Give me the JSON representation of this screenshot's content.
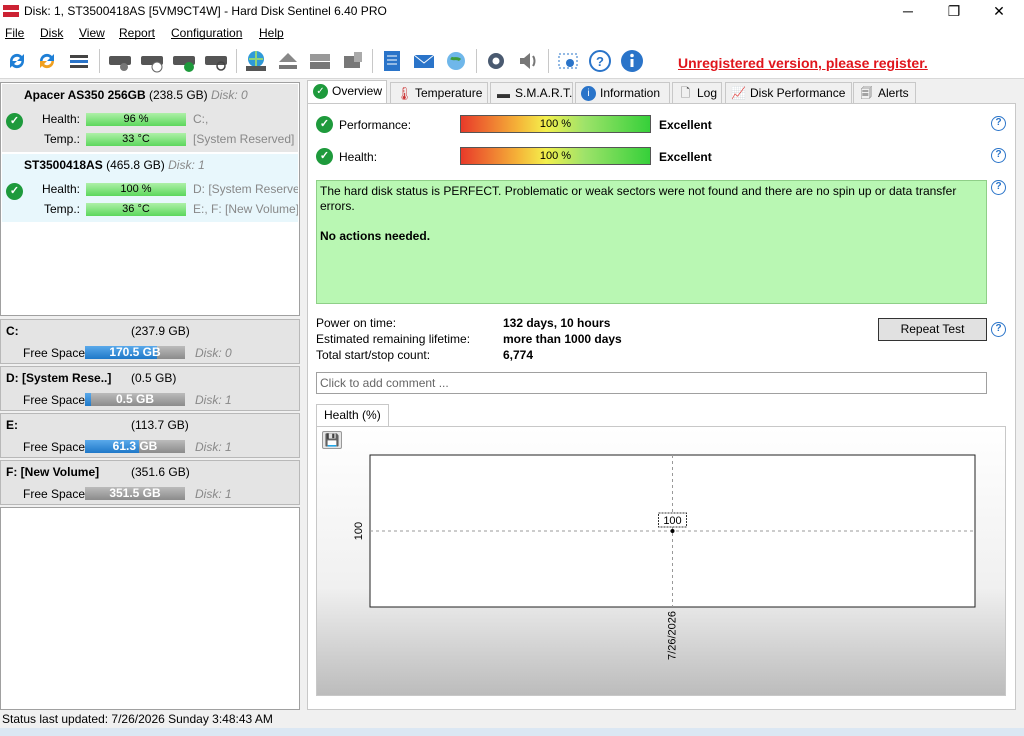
{
  "window": {
    "title": "Disk: 1, ST3500418AS [5VM9CT4W]  -  Hard Disk Sentinel 6.40 PRO",
    "minimize": "─",
    "maximize": "❐",
    "close": "✕"
  },
  "menu": [
    "File",
    "Disk",
    "View",
    "Report",
    "Configuration",
    "Help"
  ],
  "toolbar": {
    "unregistered": "Unregistered version, please register."
  },
  "disks": [
    {
      "name": "Apacer AS350 256GB",
      "size": "(238.5 GB)",
      "index": "Disk: 0",
      "health_label": "Health:",
      "health": "96 %",
      "temp_label": "Temp.:",
      "temp": "33 °C",
      "vol_line1": "C:,",
      "vol_line2": "[System Reserved]"
    },
    {
      "name": "ST3500418AS",
      "size": "(465.8 GB)",
      "index": "Disk: 1",
      "health_label": "Health:",
      "health": "100 %",
      "temp_label": "Temp.:",
      "temp": "36 °C",
      "vol_line1": "D: [System Reserved]",
      "vol_line2": "E:, F: [New Volume]"
    }
  ],
  "volumes": [
    {
      "name": "C:",
      "size": "(237.9 GB)",
      "free_label": "Free Space",
      "free": "170.5 GB",
      "fill": 0.72,
      "disk": "Disk: 0"
    },
    {
      "name": "D: [System Rese..]",
      "size": "(0.5 GB)",
      "free_label": "Free Space",
      "free": "0.5 GB",
      "fill": 0.06,
      "disk": "Disk: 1"
    },
    {
      "name": "E:",
      "size": "(113.7 GB)",
      "free_label": "Free Space",
      "free": "61.3 GB",
      "fill": 0.54,
      "disk": "Disk: 1"
    },
    {
      "name": "F: [New Volume]",
      "size": "(351.6 GB)",
      "free_label": "Free Space",
      "free": "351.5 GB",
      "fill": 0.0,
      "disk": "Disk: 1"
    }
  ],
  "tabs": [
    "Overview",
    "Temperature",
    "S.M.A.R.T.",
    "Information",
    "Log",
    "Disk Performance",
    "Alerts"
  ],
  "overview": {
    "performance_label": "Performance:",
    "performance_value": "100 %",
    "performance_text": "Excellent",
    "health_label": "Health:",
    "health_value": "100 %",
    "health_text": "Excellent",
    "status_line1": "The hard disk status is PERFECT. Problematic or weak sectors were not found and there are no spin up or data transfer errors.",
    "status_line2": "No actions needed.",
    "power_on_label": "Power on time:",
    "power_on_value": "132 days, 10 hours",
    "lifetime_label": "Estimated remaining lifetime:",
    "lifetime_value": "more than 1000 days",
    "startstop_label": "Total start/stop count:",
    "startstop_value": "6,774",
    "repeat_test": "Repeat Test",
    "comment_placeholder": "Click to add comment ...",
    "help": "?"
  },
  "chart_data": {
    "type": "line",
    "title": "Health (%)",
    "x": [
      "7/26/2026"
    ],
    "series": [
      {
        "values": [
          100
        ]
      }
    ],
    "y_tick_labels": [
      "100"
    ],
    "data_labels": [
      "100"
    ],
    "grid": true
  },
  "statusbar": {
    "text": "Status last updated: 7/26/2026 Sunday 3:48:43 AM"
  }
}
